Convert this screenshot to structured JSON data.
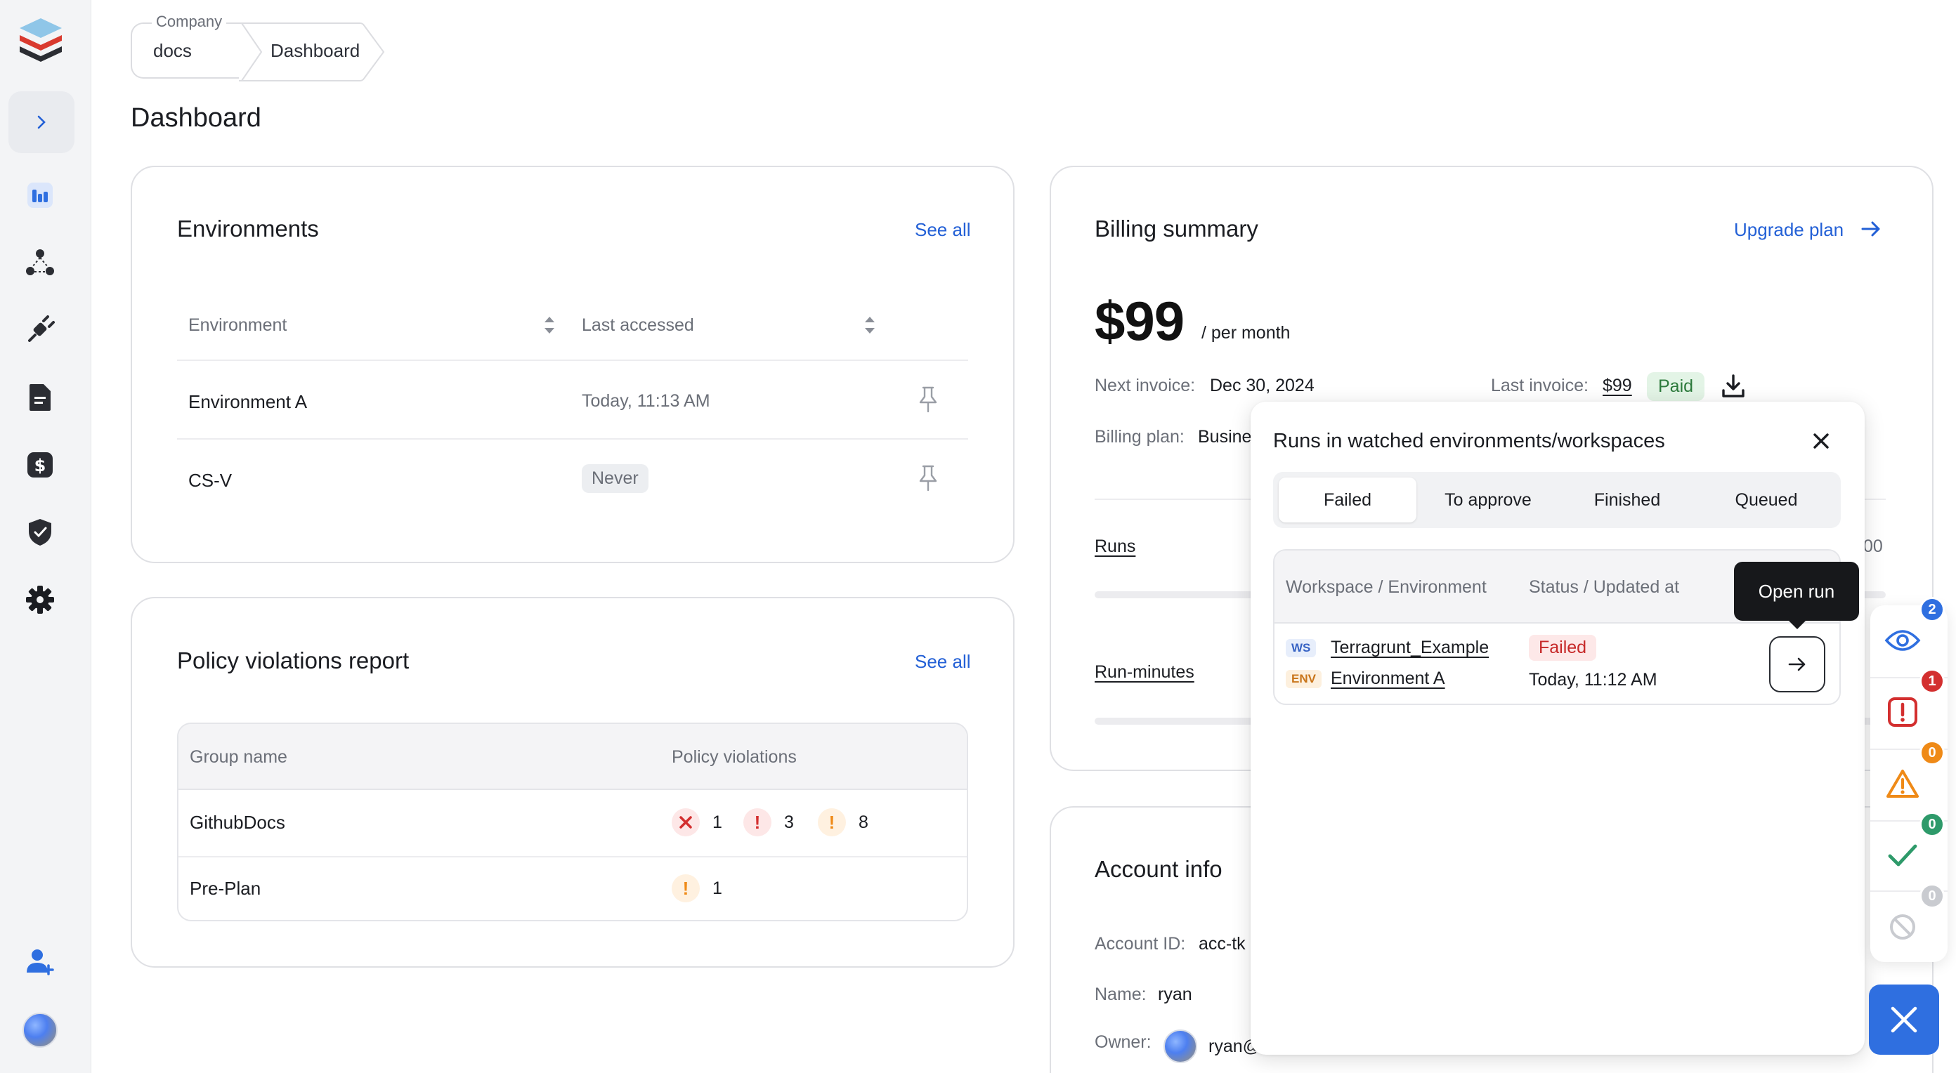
{
  "breadcrumb": {
    "company_label": "Company",
    "company_value": "docs",
    "current": "Dashboard"
  },
  "page": {
    "title": "Dashboard"
  },
  "environments": {
    "title": "Environments",
    "see_all": "See all",
    "columns": [
      "Environment",
      "Last accessed"
    ],
    "rows": [
      {
        "name": "Environment A",
        "last_accessed": "Today, 11:13 AM"
      },
      {
        "name": "CS-V",
        "last_accessed": "Never"
      }
    ]
  },
  "policy": {
    "title": "Policy violations report",
    "see_all": "See all",
    "columns": [
      "Group name",
      "Policy violations"
    ],
    "rows": [
      {
        "group": "GithubDocs",
        "critical": "1",
        "high": "3",
        "medium": "8"
      },
      {
        "group": "Pre-Plan",
        "medium": "1"
      }
    ]
  },
  "billing": {
    "title": "Billing summary",
    "upgrade": "Upgrade plan",
    "price": "$99",
    "per": "/ per month",
    "next_invoice_label": "Next invoice:",
    "next_invoice_value": "Dec 30, 2024",
    "last_invoice_label": "Last invoice:",
    "last_invoice_value": "$99",
    "paid": "Paid",
    "plan_label": "Billing plan:",
    "plan_value": "Busine",
    "runs_label": "Runs",
    "runs_right": "00",
    "runminutes_label": "Run-minutes"
  },
  "account": {
    "title": "Account info",
    "id_label": "Account ID:",
    "id_value": "acc-tk",
    "name_label": "Name:",
    "name_value": "ryan",
    "owner_label": "Owner:",
    "owner_value": "ryan@"
  },
  "popup": {
    "title": "Runs in watched environments/workspaces",
    "tabs": [
      "Failed",
      "To approve",
      "Finished",
      "Queued"
    ],
    "columns": [
      "Workspace / Environment",
      "Status / Updated at"
    ],
    "row": {
      "ws_tag": "WS",
      "workspace": "Terragrunt_Example",
      "env_tag": "ENV",
      "environment": "Environment A",
      "status": "Failed",
      "updated": "Today, 11:12 AM"
    },
    "tooltip": "Open run"
  },
  "rail": {
    "badges": {
      "watched": "2",
      "errors": "1",
      "warnings": "0",
      "success": "0",
      "cancelled": "0"
    },
    "colors": {
      "blue": "#2f6fe0",
      "red": "#d32f2f",
      "orange": "#ef8a17",
      "green": "#2e9a6a",
      "gray": "#c9cbd0"
    }
  }
}
